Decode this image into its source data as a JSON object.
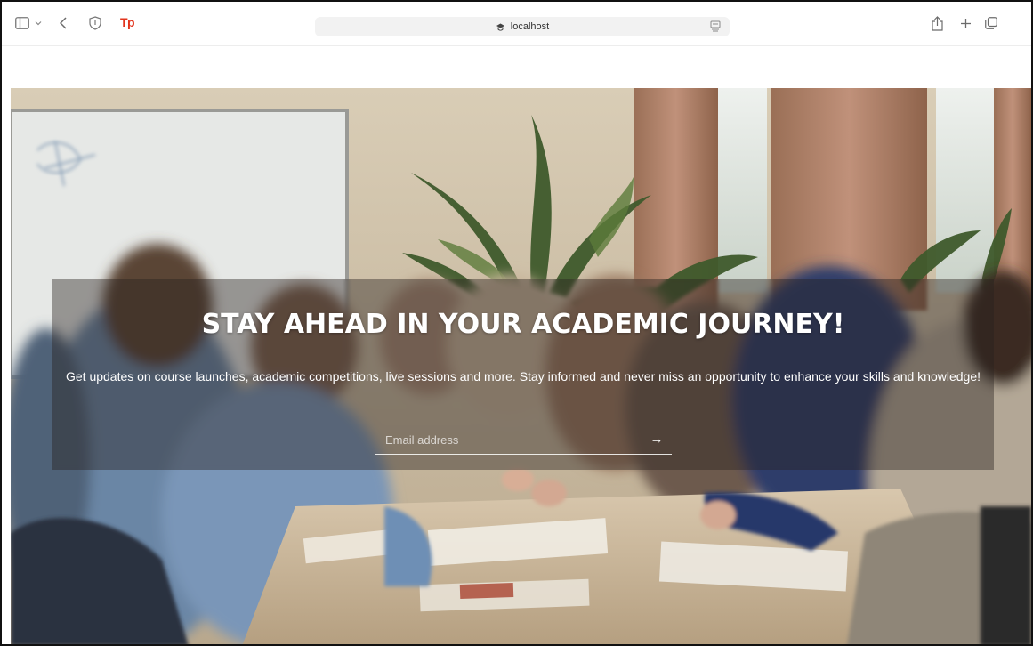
{
  "browser": {
    "url": "localhost",
    "extension_label": "Tp",
    "icons": {
      "sidebar": "sidebar-icon",
      "sidebar_menu": "chevron-down-icon",
      "back": "chevron-left-icon",
      "shield": "shield-icon",
      "favicon": "favicon-icon",
      "reader": "reader-icon",
      "share": "share-icon",
      "new_tab": "plus-icon",
      "tabs": "tabs-overview-icon"
    }
  },
  "hero": {
    "title": "STAY AHEAD IN YOUR ACADEMIC JOURNEY!",
    "subtitle": "Get updates on course launches, academic competitions, live sessions and more. Stay informed and never miss an opportunity to enhance your skills and knowledge!",
    "email_placeholder": "Email address",
    "email_value": "",
    "submit_glyph": "→"
  },
  "colors": {
    "accent_logo": "#e2341d",
    "overlay": "rgba(40,34,30,0.42)",
    "text": "#ffffff"
  }
}
